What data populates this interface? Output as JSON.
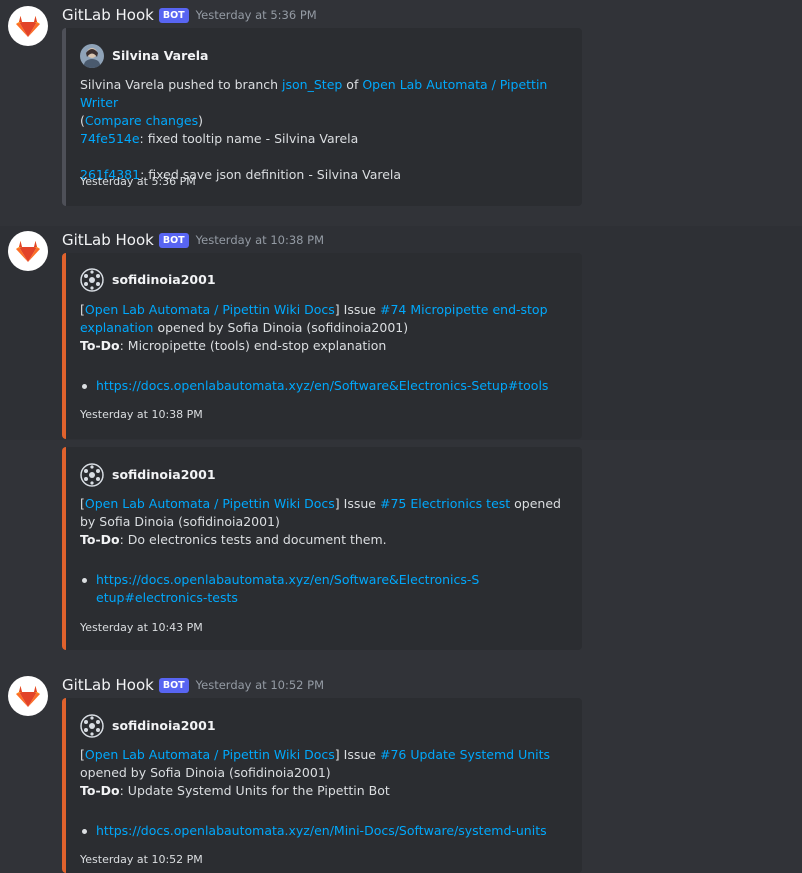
{
  "messages": [
    {
      "username": "GitLab Hook",
      "bot_tag": "BOT",
      "timestamp": "Yesterday at 5:36 PM",
      "embed": {
        "author": "Silvina Varela",
        "line1_pre": "Silvina Varela pushed to branch ",
        "branch_link": "json_Step",
        "line1_mid": " of ",
        "repo_link": "Open Lab Automata / Pipettin Writer",
        "compare_open": "(",
        "compare_link": "Compare changes",
        "compare_close": ")",
        "commit1_hash": "74fe514e",
        "commit1_text": ": fixed tooltip name - Silvina Varela",
        "commit2_hash": "261f4381",
        "commit2_text": ": fixed save json definition - Silvina Varela",
        "footer": "Yesterday at 5:36 PM"
      }
    },
    {
      "username": "GitLab Hook",
      "bot_tag": "BOT",
      "timestamp": "Yesterday at 10:38 PM",
      "embeds": [
        {
          "author": "sofidinoia2001",
          "bracket_open": "[",
          "repo_link": "Open Lab Automata / Pipettin Wiki Docs",
          "bracket_close": "]",
          "issue_word": " Issue ",
          "issue_link": "#74 Micropipette end-stop explanation",
          "opened_by": " opened by Sofia Dinoia (sofidinoia2001)",
          "todo_label": "To-Do",
          "todo_text": ": Micropipette (tools) end-stop explanation",
          "bullet_link": "https://docs.openlabautomata.xyz/en/Software&Electronics-Setup#tools",
          "footer": "Yesterday at 10:38 PM"
        },
        {
          "author": "sofidinoia2001",
          "bracket_open": "[",
          "repo_link": "Open Lab Automata / Pipettin Wiki Docs",
          "bracket_close": "]",
          "issue_word": " Issue ",
          "issue_link": "#75 Electrionics test",
          "opened_by": " opened by Sofia Dinoia (sofidinoia2001)",
          "todo_label": "To-Do",
          "todo_text": ": Do electronics tests and document them.",
          "bullet_link": "https://docs.openlabautomata.xyz/en/Software&Electronics-Setup#electronics-tests",
          "footer": "Yesterday at 10:43 PM"
        }
      ]
    },
    {
      "username": "GitLab Hook",
      "bot_tag": "BOT",
      "timestamp": "Yesterday at 10:52 PM",
      "embed": {
        "author": "sofidinoia2001",
        "bracket_open": "[",
        "repo_link": "Open Lab Automata / Pipettin Wiki Docs",
        "bracket_close": "]",
        "issue_word": " Issue ",
        "issue_link": "#76 Update Systemd Units",
        "opened_by": " opened by Sofia Dinoia (sofidinoia2001)",
        "todo_label": "To-Do",
        "todo_text": ": Update Systemd Units for the Pipettin Bot",
        "bullet_link": "https://docs.openlabautomata.xyz/en/Mini-Docs/Software/systemd-units",
        "footer": "Yesterday at 10:52 PM"
      }
    }
  ],
  "colors": {
    "background": "#313338",
    "embed_background": "#2b2d31",
    "embed_border_push": "#4e5058",
    "embed_border_issue": "#e0622d",
    "link": "#00a8fc",
    "bot_tag": "#5865f2",
    "gitlab_orange": "#e24329"
  },
  "icons": {
    "avatar": "gitlab-fox-icon",
    "author_push": "user-photo",
    "author_issue": "identicon"
  }
}
